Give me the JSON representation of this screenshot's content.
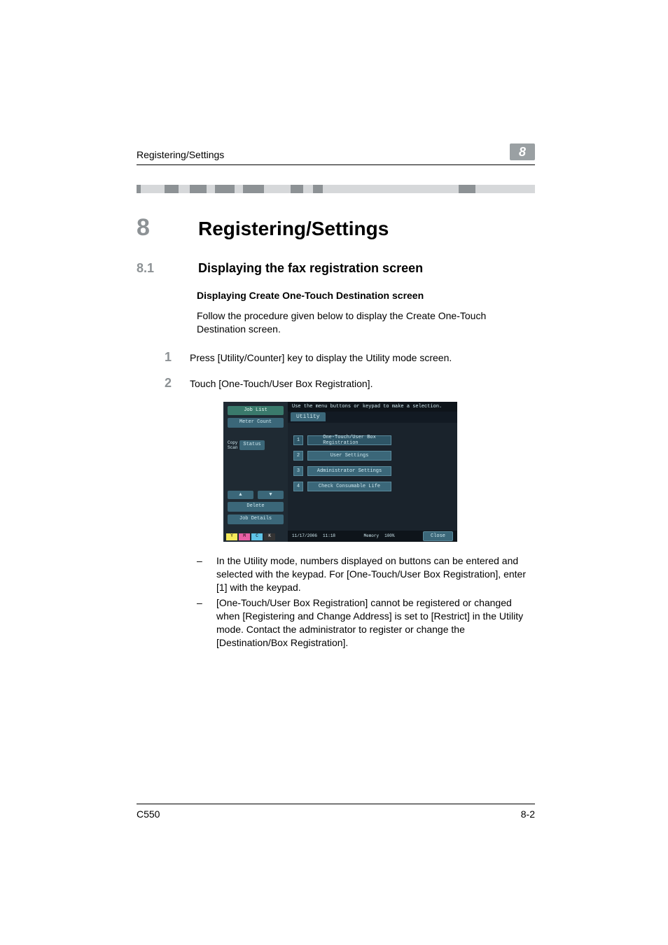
{
  "running_header": {
    "section": "Registering/Settings",
    "chapter_badge": "8"
  },
  "h1": {
    "num": "8",
    "title": "Registering/Settings"
  },
  "h2": {
    "num": "8.1",
    "title": "Displaying the fax registration screen"
  },
  "subhead": "Displaying Create One-Touch Destination screen",
  "intro": "Follow the procedure given below to display the Create One-Touch Destination screen.",
  "steps": [
    {
      "num": "1",
      "text": "Press [Utility/Counter] key to display the Utility mode screen."
    },
    {
      "num": "2",
      "text": "Touch [One-Touch/User Box Registration]."
    }
  ],
  "panel": {
    "top_msg": "Use the menu buttons or keypad to make a selection.",
    "tab": "Utility",
    "left": {
      "job_list": "Job List",
      "meter_count": "Meter Count",
      "status_label": "Status",
      "delete": "Delete",
      "job_details": "Job Details"
    },
    "items": [
      {
        "n": "1",
        "label": "One-Touch/User Box\nRegistration"
      },
      {
        "n": "2",
        "label": "User Settings"
      },
      {
        "n": "3",
        "label": "Administrator Settings"
      },
      {
        "n": "4",
        "label": "Check Consumable Life"
      }
    ],
    "footer": {
      "date": "11/17/2006",
      "time": "11:18",
      "memory_label": "Memory",
      "memory_value": "100%",
      "close": "Close"
    },
    "toner": [
      "Y",
      "M",
      "C",
      "K"
    ]
  },
  "bullets": [
    "In the Utility mode, numbers displayed on buttons can be entered and selected with the keypad. For [One-Touch/User Box Registration], enter [1] with the keypad.",
    "[One-Touch/User Box Registration] cannot be registered or changed when [Registering and Change Address] is set to [Restrict] in the Utility mode. Contact the administrator to register or change the [Destination/Box Registration]."
  ],
  "footer": {
    "model": "C550",
    "page": "8-2"
  }
}
